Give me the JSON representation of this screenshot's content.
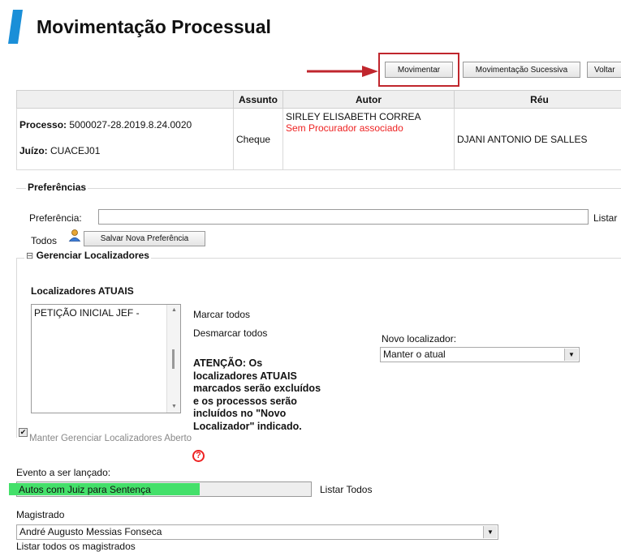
{
  "header": {
    "title": "Movimentação Processual"
  },
  "toolbar": {
    "movimentar": "Movimentar",
    "mov_sucessiva": "Movimentação Sucessiva",
    "voltar": "Voltar"
  },
  "table": {
    "headers": [
      "",
      "Assunto",
      "Autor",
      "Réu"
    ],
    "processo_label": "Processo:",
    "processo_value": "5000027-28.2019.8.24.0020",
    "juizo_label": "Juízo:",
    "juizo_value": "CUACEJ01",
    "assunto": "Cheque",
    "autor_name": "SIRLEY ELISABETH CORREA",
    "autor_note": "Sem Procurador associado",
    "reu": "DJANI ANTONIO DE SALLES"
  },
  "preferencias": {
    "legend": "Preferências",
    "field_label": "Preferência:",
    "value": "",
    "listar": "Listar",
    "todos": "Todos",
    "save_button": "Salvar Nova Preferência"
  },
  "localizadores": {
    "toggle": "⊟",
    "legend": "Gerenciar Localizadores",
    "atuais_title": "Localizadores ATUAIS",
    "items": [
      "PETIÇÃO INICIAL JEF -"
    ],
    "marcar": "Marcar todos",
    "desmarcar": "Desmarcar todos",
    "atencao": "ATENÇÃO: Os localizadores ATUAIS marcados serão excluídos e os processos serão incluídos no \"Novo Localizador\" indicado.",
    "help": "?",
    "novo_label": "Novo localizador:",
    "novo_value": "Manter o atual",
    "manter_checkbox": "Manter Gerenciar Localizadores Aberto"
  },
  "evento": {
    "label": "Evento a ser lançado:",
    "value": "Autos com Juiz para Sentença",
    "listar": "Listar Todos"
  },
  "magistrado": {
    "label": "Magistrado",
    "value": "André Augusto Messias Fonseca",
    "listar": "Listar todos os magistrados"
  },
  "colors": {
    "accent": "#1a8fd8",
    "red_box": "#c0262d",
    "highlight": "#44e06a",
    "note": "#e22222"
  }
}
